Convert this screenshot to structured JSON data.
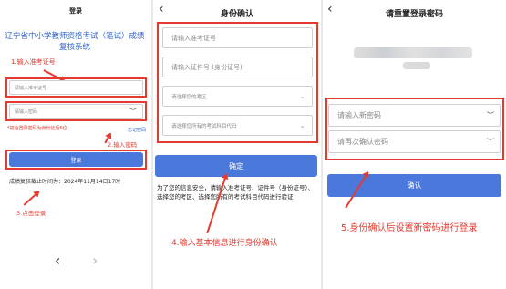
{
  "panel1": {
    "title": "登录",
    "heading": "辽宁省中小学教师资格考试（笔试）成绩复核系统",
    "step1": "1.输入准考证号",
    "exam_placeholder": "请输入准考证号",
    "password_placeholder": "请输入密码",
    "hint": "*初始登录密码为身份证后6位",
    "forgot": "忘记密码",
    "step2": "2.输入密码",
    "login_button": "登录",
    "deadline": "成绩复核截止时间为：2024年11月14日17时",
    "step3": "3.点击登录",
    "nav_back": "‹",
    "nav_forward": "›"
  },
  "panel2": {
    "back": "‹",
    "title": "身份确认",
    "exam_placeholder": "请输入准考证号",
    "id_placeholder": "请输入证件号 (身份证号)",
    "area_placeholder": "请选择您的考区",
    "subject_placeholder": "请选择您所有的考试科目代码",
    "confirm_button": "确定",
    "notice": "为了您的信息安全，请输入准考证号、证件号（身份证号）、选择您的考区、选择您所有的考试科目代码进行验证",
    "step4": "4.输入基本信息进行身份确认"
  },
  "panel3": {
    "back": "‹",
    "title": "请重置登录密码",
    "new_password_placeholder": "请输入新密码",
    "confirm_password_placeholder": "请再次确认密码",
    "confirm_button": "确认",
    "step5": "5.身份确认后设置新密码进行登录"
  },
  "colors": {
    "accent": "#4a78db",
    "annotation": "#e53a2f"
  }
}
